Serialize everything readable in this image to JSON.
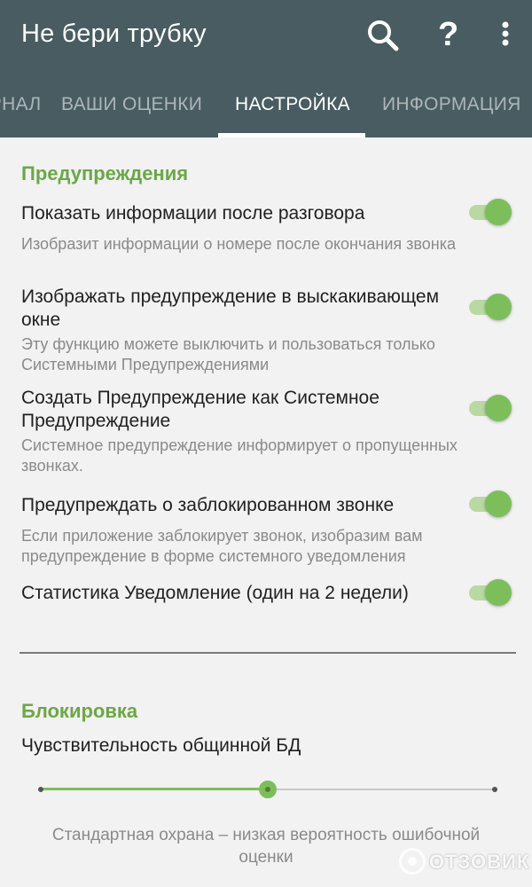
{
  "app": {
    "title": "Не бери трубку",
    "colors": {
      "appbar": "#485c61",
      "accent": "#6aa844",
      "switch_on": "#7cbf5a"
    }
  },
  "actions": {
    "icons": [
      "search-icon",
      "help-icon",
      "more-vert-icon"
    ],
    "help_glyph": "?"
  },
  "tabs": [
    {
      "label": "ЖУРНАЛ",
      "visible_text": "ЖУРНАЛ"
    },
    {
      "label": "ВАШИ ОЦЕНКИ"
    },
    {
      "label": "НАСТРОЙКА",
      "active": true
    },
    {
      "label": "ИНФОРМАЦИЯ"
    }
  ],
  "warnings": {
    "title": "Предупреждения",
    "items": [
      {
        "title": "Показать информации после разговора",
        "summary": "Изобразит информации о номере после окончания звонка",
        "enabled": true
      },
      {
        "title": "Изображать предупреждение в выскакивающем окне",
        "summary": "Эту функцию можете выключить и пользоваться только Системными Предупреждениями",
        "enabled": true
      },
      {
        "title": "Создать Предупреждение как Системное Предупреждение",
        "summary": "Системное предупреждение информирует о пропущенных звонках.",
        "enabled": true
      },
      {
        "title": "Предупреждать о заблокированном звонке",
        "summary": "Если приложение заблокирует звонок, изобразим вам предупреждение в форме системного уведомления",
        "enabled": true
      },
      {
        "title": "Статистика Уведомление (один на 2 недели)",
        "summary": "",
        "enabled": true
      }
    ]
  },
  "blocking": {
    "title": "Блокировка",
    "sensitivity_label": "Чувствительность общинной БД",
    "slider": {
      "steps": 3,
      "selected_index": 1,
      "fraction": 0.5
    },
    "caption": "Стандартная охрана – низкая вероятность ошибочной оценки"
  },
  "watermark": {
    "text": "ОТЗОВИК"
  }
}
